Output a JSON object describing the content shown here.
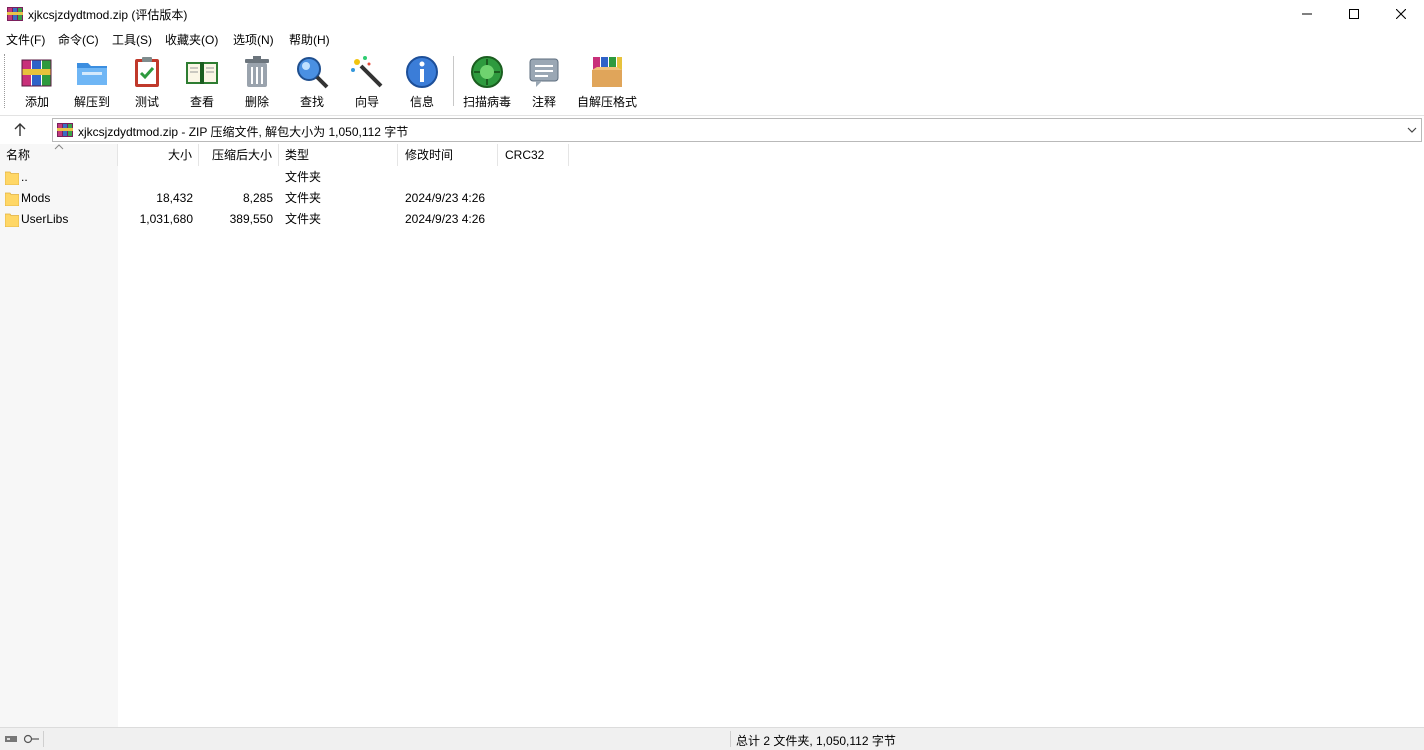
{
  "window": {
    "title": "xjkcsjzdydtmod.zip (评估版本)"
  },
  "menu": [
    "文件(F)",
    "命令(C)",
    "工具(S)",
    "收藏夹(O)",
    "选项(N)",
    "帮助(H)"
  ],
  "toolbar": {
    "add": "添加",
    "extract": "解压到",
    "test": "测试",
    "view": "查看",
    "delete": "删除",
    "find": "查找",
    "wizard": "向导",
    "info": "信息",
    "virus_scan": "扫描病毒",
    "comment": "注释",
    "sfx": "自解压格式"
  },
  "address": {
    "text": "xjkcsjzdydtmod.zip - ZIP 压缩文件, 解包大小为 1,050,112 字节"
  },
  "columns": {
    "name": "名称",
    "size": "大小",
    "packed": "压缩后大小",
    "type": "类型",
    "modified": "修改时间",
    "crc": "CRC32"
  },
  "rows": [
    {
      "name": "..",
      "size": "",
      "packed": "",
      "type": "文件夹",
      "modified": "",
      "crc": ""
    },
    {
      "name": "Mods",
      "size": "18,432",
      "packed": "8,285",
      "type": "文件夹",
      "modified": "2024/9/23 4:26",
      "crc": ""
    },
    {
      "name": "UserLibs",
      "size": "1,031,680",
      "packed": "389,550",
      "type": "文件夹",
      "modified": "2024/9/23 4:26",
      "crc": ""
    }
  ],
  "status": {
    "summary": "总计 2 文件夹, 1,050,112 字节"
  },
  "colors": {
    "folder": "#ffd766",
    "folder_edge": "#e0b040",
    "name_column_bg": "#f7f7f7",
    "statusbar_bg": "#f0f0f0"
  }
}
